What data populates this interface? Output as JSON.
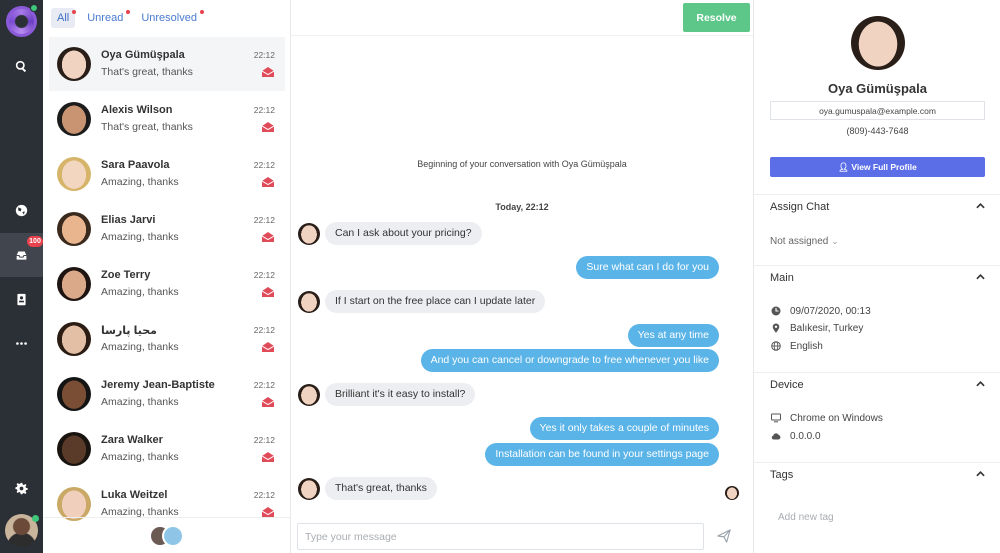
{
  "rail": {
    "unread_badge": "100",
    "icons": [
      "logo-icon",
      "search-icon",
      "globe-icon",
      "inbox-icon",
      "contacts-icon",
      "more-icon",
      "settings-icon"
    ]
  },
  "filters": [
    {
      "label": "All",
      "active": true
    },
    {
      "label": "Unread",
      "active": false
    },
    {
      "label": "Unresolved",
      "active": false
    }
  ],
  "conversations": [
    {
      "name": "Oya Gümüşpala",
      "preview": "That's great, thanks",
      "time": "22:12",
      "active": true
    },
    {
      "name": "Alexis Wilson",
      "preview": "That's great, thanks",
      "time": "22:12",
      "active": false
    },
    {
      "name": "Sara Paavola",
      "preview": "Amazing, thanks",
      "time": "22:12",
      "active": false
    },
    {
      "name": "Elias Jarvi",
      "preview": "Amazing, thanks",
      "time": "22:12",
      "active": false
    },
    {
      "name": "Zoe Terry",
      "preview": "Amazing, thanks",
      "time": "22:12",
      "active": false
    },
    {
      "name": "محیا پارسا",
      "preview": "Amazing, thanks",
      "time": "22:12",
      "active": false
    },
    {
      "name": "Jeremy Jean-Baptiste",
      "preview": "Amazing, thanks",
      "time": "22:12",
      "active": false
    },
    {
      "name": "Zara Walker",
      "preview": "Amazing, thanks",
      "time": "22:12",
      "active": false
    },
    {
      "name": "Luka Weitzel",
      "preview": "Amazing, thanks",
      "time": "22:12",
      "active": false
    }
  ],
  "chat": {
    "resolve_label": "Resolve",
    "beginning": "Beginning of your conversation with Oya Gümüşpala",
    "day_label": "Today, 22:12",
    "messages": [
      {
        "from": "visitor",
        "text": "Can I ask about your pricing?"
      },
      {
        "from": "agent",
        "text": "Sure what can I do for you"
      },
      {
        "from": "visitor",
        "text": "If I start on the free place can I update later"
      },
      {
        "from": "agent",
        "text": "Yes at any time"
      },
      {
        "from": "agent",
        "text": "And you can cancel or downgrade to free whenever you like"
      },
      {
        "from": "visitor",
        "text": "Brilliant it's it easy to install?"
      },
      {
        "from": "agent",
        "text": "Yes it only takes a couple of minutes"
      },
      {
        "from": "agent",
        "text": "Installation can be found in your settings page"
      },
      {
        "from": "visitor",
        "text": "That's great, thanks"
      }
    ],
    "composer_placeholder": "Type your message"
  },
  "profile": {
    "name": "Oya Gümüşpala",
    "email": "oya.gumuspala@example.com",
    "phone": "(809)-443-7648",
    "view_profile_label": "View Full Profile",
    "assign_header": "Assign Chat",
    "assign_value": "Not assigned",
    "main_header": "Main",
    "datetime": "09/07/2020, 00:13",
    "location": "Balıkesir, Turkey",
    "language": "English",
    "device_header": "Device",
    "browser": "Chrome on Windows",
    "ip": "0.0.0.0",
    "tags_header": "Tags",
    "tag_placeholder": "Add new tag"
  },
  "colors": {
    "rail_bg": "#2b2f36",
    "resolve_green": "#5dc78a",
    "agent_bubble": "#5ab4e8",
    "visitor_bubble": "#eceef1",
    "profile_button": "#5b6ee8",
    "badge_red": "#e8424c",
    "mail_icon_red": "#e04b5a"
  }
}
